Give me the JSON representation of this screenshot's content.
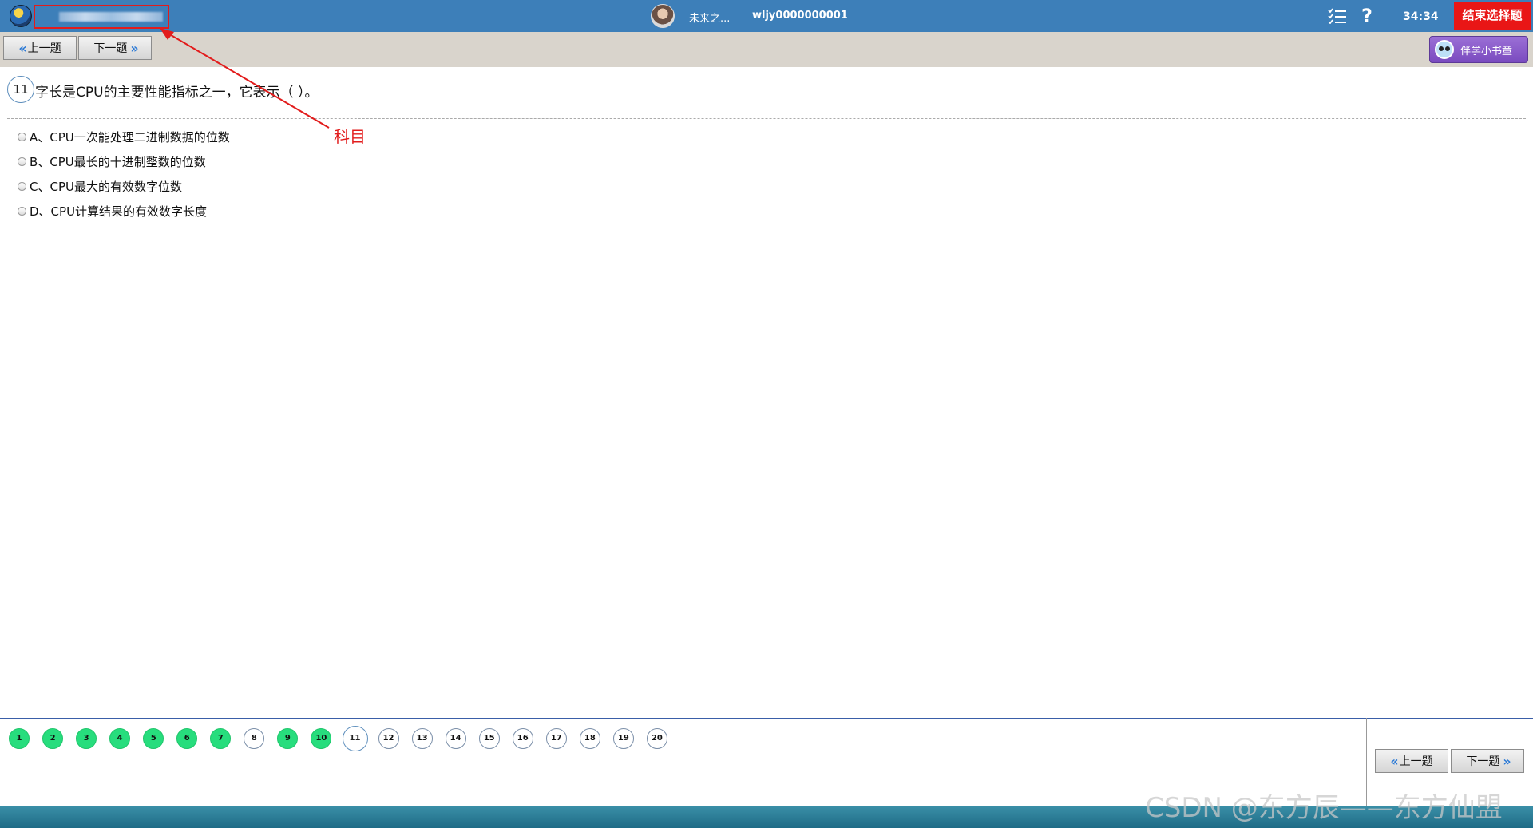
{
  "header": {
    "user_name": "未来之...",
    "user_id": "wljy0000000001",
    "help_symbol": "?",
    "timer": "34:34",
    "end_button_label": "结束选择题"
  },
  "toolbar": {
    "prev_label": "上一题",
    "next_label": "下一题",
    "helper_label": "伴学小书童"
  },
  "question": {
    "number": "11",
    "text": "字长是CPU的主要性能指标之一，它表示（  ）。",
    "options": [
      "A、CPU一次能处理二进制数据的位数",
      "B、CPU最长的十进制整数的位数",
      "C、CPU最大的有效数字位数",
      "D、CPU计算结果的有效数字长度"
    ]
  },
  "annotation": {
    "label": "科目",
    "color": "#e21c1c"
  },
  "navigator": {
    "numbers": [
      "1",
      "2",
      "3",
      "4",
      "5",
      "6",
      "7",
      "8",
      "9",
      "10",
      "11",
      "12",
      "13",
      "14",
      "15",
      "16",
      "17",
      "18",
      "19",
      "20"
    ],
    "answered": [
      1,
      2,
      3,
      4,
      5,
      6,
      7,
      9,
      10
    ],
    "current": 11,
    "prev_label": "上一题",
    "next_label": "下一题"
  },
  "colors": {
    "header_bg": "#3d7fb9",
    "end_button": "#e91616",
    "answered": "#27dd7d",
    "helper": "#8a5bd0"
  },
  "watermark": "CSDN @东方辰——东方仙盟"
}
